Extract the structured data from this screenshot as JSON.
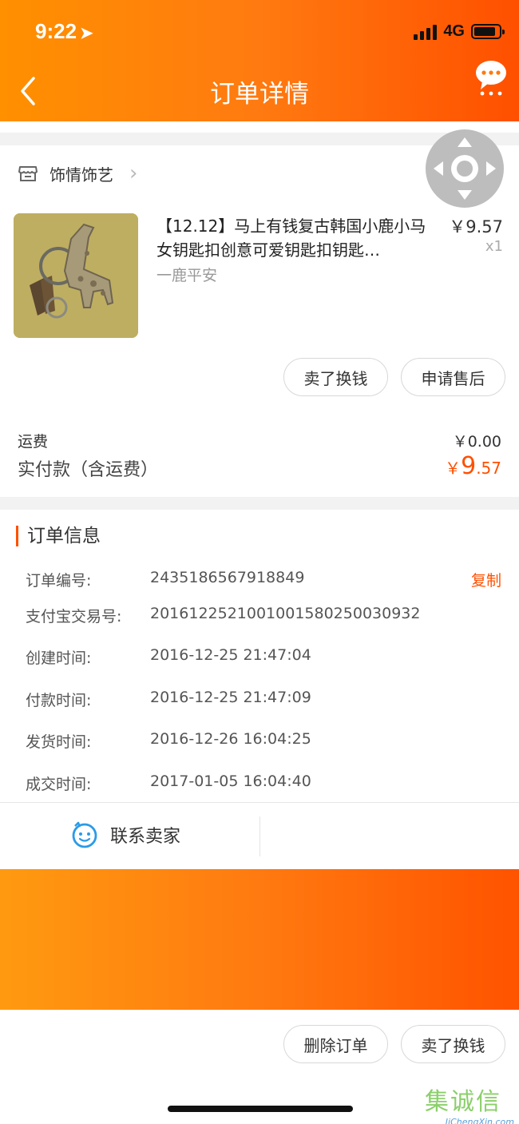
{
  "status_bar": {
    "time": "9:22",
    "network": "4G"
  },
  "header": {
    "title": "订单详情"
  },
  "shop": {
    "name": "饰情饰艺"
  },
  "product": {
    "title": "【12.12】马上有钱复古韩国小鹿小马女钥匙扣创意可爱钥匙扣钥匙…",
    "sku": "一鹿平安",
    "price": "￥9.57",
    "qty": "x1"
  },
  "item_actions": {
    "sell": "卖了换钱",
    "after_sale": "申请售后"
  },
  "totals": {
    "shipping_label": "运费",
    "shipping_value": "￥0.00",
    "paid_label": "实付款（含运费）",
    "paid_currency": "￥",
    "paid_int": "9",
    "paid_dec": ".57"
  },
  "order_info": {
    "title": "订单信息",
    "copy_label": "复制",
    "rows": [
      {
        "label": "订单编号:",
        "value": "2435186567918849"
      },
      {
        "label": "支付宝交易号:",
        "value": "2016122521001001580250030932"
      },
      {
        "label": "创建时间:",
        "value": "2016-12-25 21:47:04"
      },
      {
        "label": "付款时间:",
        "value": "2016-12-25 21:47:09"
      },
      {
        "label": "发货时间:",
        "value": "2016-12-26 16:04:25"
      },
      {
        "label": "成交时间:",
        "value": "2017-01-05 16:04:40"
      }
    ]
  },
  "contact": {
    "label": "联系卖家"
  },
  "bottom_actions": {
    "delete": "删除订单",
    "sell": "卖了换钱"
  },
  "watermark": {
    "text": "集诚信",
    "sub": "JiChengXin.com"
  },
  "colors": {
    "accent": "#ff5000",
    "header_start": "#ff9000",
    "header_end": "#ff5000"
  },
  "icons": [
    "location-arrow-icon",
    "signal-icon",
    "battery-icon",
    "back-chevron-icon",
    "message-icon",
    "shop-icon",
    "chevron-right-icon",
    "float-control-icon",
    "contact-face-icon"
  ]
}
